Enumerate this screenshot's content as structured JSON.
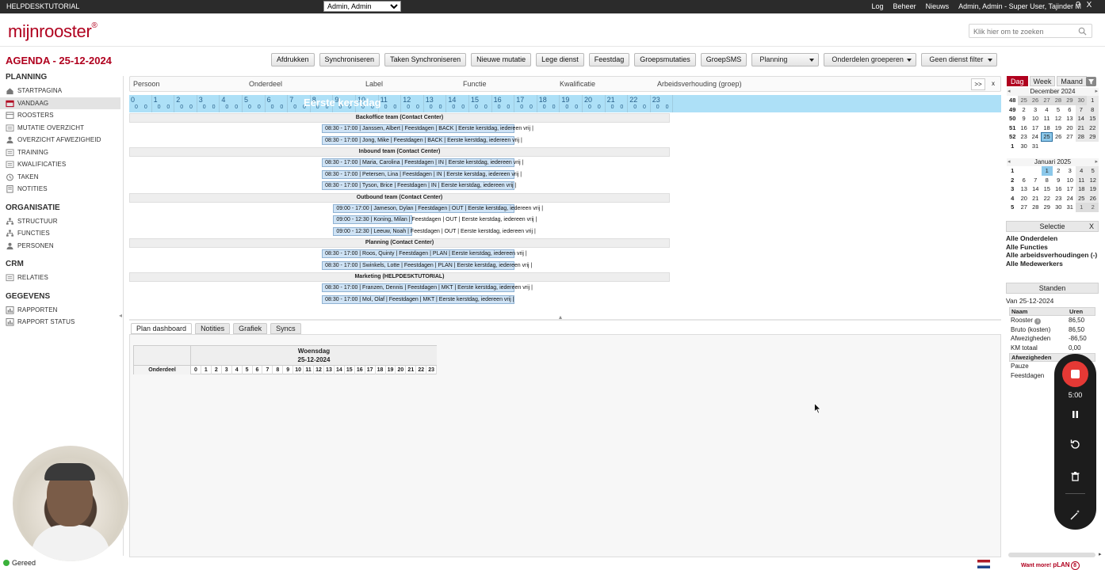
{
  "topbar": {
    "brand": "HELPDESKTUTORIAL",
    "user_select": "Admin, Admin",
    "nav": [
      "Log",
      "Beheer",
      "Nieuws",
      "Admin, Admin - Super User, Tajinder M"
    ],
    "help": "?",
    "close": "X"
  },
  "logo": {
    "text": "mijnrooster",
    "mark": "®"
  },
  "search": {
    "placeholder": "Klik hier om te zoeken"
  },
  "page_title": "AGENDA - 25-12-2024",
  "toolbar": {
    "buttons": [
      "Afdrukken",
      "Synchroniseren",
      "Taken Synchroniseren",
      "Nieuwe mutatie",
      "Lege dienst",
      "Feestdag",
      "Groepsmutaties",
      "GroepSMS"
    ],
    "selects": [
      "Planning",
      "Onderdelen groeperen",
      "Geen dienst filter"
    ]
  },
  "sidebar": {
    "sections": [
      {
        "title": "PLANNING",
        "items": [
          "STARTPAGINA",
          "VANDAAG",
          "ROOSTERS",
          "MUTATIE OVERZICHT",
          "OVERZICHT AFWEZIGHEID",
          "TRAINING",
          "KWALIFICATIES",
          "TAKEN",
          "NOTITIES"
        ]
      },
      {
        "title": "ORGANISATIE",
        "items": [
          "STRUCTUUR",
          "FUNCTIES",
          "PERSONEN"
        ]
      },
      {
        "title": "CRM",
        "items": [
          "RELATIES"
        ]
      },
      {
        "title": "GEGEVENS",
        "items": [
          "RAPPORTEN",
          "RAPPORT STATUS"
        ]
      }
    ],
    "selected": "VANDAAG",
    "icons": {
      "STARTPAGINA": "home-icon",
      "VANDAAG": "calendar-icon",
      "ROOSTERS": "schedule-icon",
      "MUTATIE OVERZICHT": "list-icon",
      "OVERZICHT AFWEZIGHEID": "person-icon",
      "TRAINING": "list-icon",
      "KWALIFICATIES": "list-icon",
      "TAKEN": "clock-icon",
      "NOTITIES": "notes-icon",
      "STRUCTUUR": "structure-icon",
      "FUNCTIES": "structure-icon",
      "PERSONEN": "person-icon",
      "RELATIES": "list-icon",
      "RAPPORTEN": "report-icon",
      "RAPPORT STATUS": "report-icon"
    }
  },
  "grid": {
    "columns": [
      "Persoon",
      "Onderdeel",
      "Label",
      "Functie",
      "Kwalificatie",
      "Arbeidsverhouding (groep)"
    ],
    "expand": ">>",
    "close": "x",
    "hours": [
      "0",
      "1",
      "2",
      "3",
      "4",
      "5",
      "6",
      "7",
      "8",
      "9",
      "10",
      "11",
      "12",
      "13",
      "14",
      "15",
      "16",
      "17",
      "18",
      "19",
      "20",
      "21",
      "22",
      "23"
    ],
    "quarter": "0 0",
    "holiday": "Eerste kerstdag",
    "rows": [
      {
        "type": "group",
        "label": "Backoffice team (Contact Center)"
      },
      {
        "type": "shift",
        "start": 8.5,
        "end": 17,
        "label": "08:30 - 17:00  |  Janssen, Albert  | Feestdagen |  BACK  |  Eerste kerstdag, iedereen vrij  |"
      },
      {
        "type": "shift",
        "start": 8.5,
        "end": 17,
        "label": "08:30 - 17:00  |  Jong, Mike  | Feestdagen |  BACK  |  Eerste kerstdag, iedereen vrij  |"
      },
      {
        "type": "group",
        "label": "Inbound team (Contact Center)"
      },
      {
        "type": "shift",
        "start": 8.5,
        "end": 17,
        "label": "08:30 - 17:00  |  Maria, Carolina  | Feestdagen |  IN  |  Eerste kerstdag, iedereen vrij  |"
      },
      {
        "type": "shift",
        "start": 8.5,
        "end": 17,
        "label": "08:30 - 17:00  |  Petersen, Lina  | Feestdagen |  IN  |  Eerste kerstdag, iedereen vrij  |"
      },
      {
        "type": "shift",
        "start": 8.5,
        "end": 17,
        "label": "08:30 - 17:00  |  Tyson, Brice  | Feestdagen |  IN  |  Eerste kerstdag, iedereen vrij  |"
      },
      {
        "type": "group",
        "label": "Outbound team (Contact Center)"
      },
      {
        "type": "shift",
        "start": 9,
        "end": 17,
        "label": "09:00 - 17:00  |  Jameson, Dylan  | Feestdagen |  OUT  |  Eerste kerstdag, iedereen vrij  |"
      },
      {
        "type": "shift",
        "start": 9,
        "end": 12.5,
        "label": "09:00 - 12:30  |  Koning, Milan  | Feestdagen |  OUT  |  Eerste kerstdag, iedereen vrij  |"
      },
      {
        "type": "shift",
        "start": 9,
        "end": 12.5,
        "label": "09:00 - 12:30  |  Leeuw, Noah  | Feestdagen |  OUT  |  Eerste kerstdag, iedereen vrij  |"
      },
      {
        "type": "group",
        "label": "Planning (Contact Center)"
      },
      {
        "type": "shift",
        "start": 8.5,
        "end": 17,
        "label": "08:30 - 17:00  |  Roos, Quinty  | Feestdagen |  PLAN  |  Eerste kerstdag, iedereen vrij  |"
      },
      {
        "type": "shift",
        "start": 8.5,
        "end": 17,
        "label": "08:30 - 17:00  |  Swinkels, Lotte  | Feestdagen |  PLAN  |  Eerste kerstdag, iedereen vrij  |"
      },
      {
        "type": "group",
        "label": "Marketing (HELPDESKTUTORIAL)"
      },
      {
        "type": "shift",
        "start": 8.5,
        "end": 17,
        "label": "08:30 - 17:00  |  Franzen, Dennis  | Feestdagen |  MKT  |  Eerste kerstdag, iedereen vrij  |"
      },
      {
        "type": "shift",
        "start": 8.5,
        "end": 17,
        "label": "08:30 - 17:00  |  Mol, Olaf  | Feestdagen |  MKT  |  Eerste kerstdag, iedereen vrij  |"
      }
    ]
  },
  "bottom_tabs": [
    "Plan dashboard",
    "Notities",
    "Grafiek",
    "Syncs"
  ],
  "dashboard": {
    "day": "Woensdag",
    "date": "25-12-2024",
    "col": "Onderdeel"
  },
  "calendar": {
    "tabs": [
      "Dag",
      "Week",
      "Maand"
    ],
    "months": [
      {
        "title": "December 2024",
        "weeks": [
          {
            "wk": "48",
            "days": [
              "25",
              "26",
              "27",
              "28",
              "29",
              "30",
              "1"
            ]
          },
          {
            "wk": "49",
            "days": [
              "2",
              "3",
              "4",
              "5",
              "6",
              "7",
              "8"
            ]
          },
          {
            "wk": "50",
            "days": [
              "9",
              "10",
              "11",
              "12",
              "13",
              "14",
              "15"
            ]
          },
          {
            "wk": "51",
            "days": [
              "16",
              "17",
              "18",
              "19",
              "20",
              "21",
              "22"
            ]
          },
          {
            "wk": "52",
            "days": [
              "23",
              "24",
              "25",
              "26",
              "27",
              "28",
              "29"
            ]
          },
          {
            "wk": "1",
            "days": [
              "30",
              "31",
              "",
              "",
              "",
              "",
              ""
            ]
          }
        ]
      },
      {
        "title": "Januari 2025",
        "weeks": [
          {
            "wk": "1",
            "days": [
              "",
              "",
              "1",
              "2",
              "3",
              "4",
              "5"
            ]
          },
          {
            "wk": "2",
            "days": [
              "6",
              "7",
              "8",
              "9",
              "10",
              "11",
              "12"
            ]
          },
          {
            "wk": "3",
            "days": [
              "13",
              "14",
              "15",
              "16",
              "17",
              "18",
              "19"
            ]
          },
          {
            "wk": "4",
            "days": [
              "20",
              "21",
              "22",
              "23",
              "24",
              "25",
              "26"
            ]
          },
          {
            "wk": "5",
            "days": [
              "27",
              "28",
              "29",
              "30",
              "31",
              "1",
              "2"
            ]
          }
        ]
      }
    ],
    "today": "25"
  },
  "selectie": {
    "title": "Selectie",
    "close": "X",
    "items": [
      "Alle Onderdelen",
      "Alle Functies",
      "Alle arbeidsverhoudingen (-)",
      "Alle Medewerkers"
    ]
  },
  "standen": {
    "title": "Standen",
    "from": "Van 25-12-2024",
    "headers": [
      "Naam",
      "Uren"
    ],
    "rows": [
      {
        "name": "Rooster",
        "value": "86,50"
      },
      {
        "name": "Bruto (kosten)",
        "value": "86,50"
      },
      {
        "name": "Afwezigheden",
        "value": "-86,50"
      },
      {
        "name": "KM totaal",
        "value": "0,00"
      }
    ],
    "section2": "Afwezigheden",
    "rows2": [
      "Pauze",
      "Feestdagen"
    ]
  },
  "recorder": {
    "timer": "5:00"
  },
  "status": "Gereed",
  "footer": {
    "want": "Want more!",
    "brand": "pLAN",
    "num": "8"
  }
}
